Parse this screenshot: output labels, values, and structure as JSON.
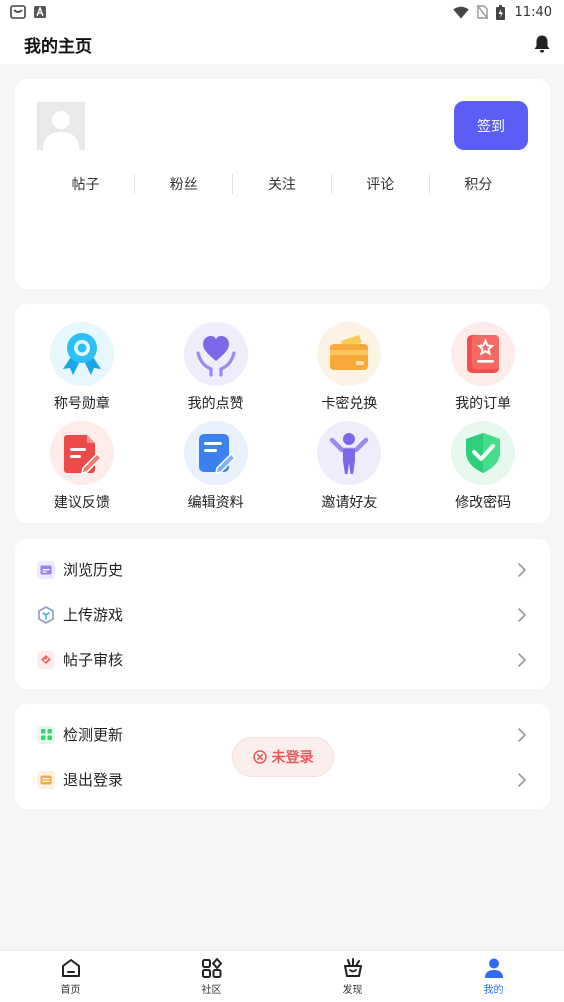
{
  "status_bar": {
    "time": "11:40"
  },
  "header": {
    "title": "我的主页"
  },
  "profile": {
    "signin_label": "签到",
    "stats": [
      "帖子",
      "粉丝",
      "关注",
      "评论",
      "积分"
    ]
  },
  "grid": [
    {
      "label": "称号勋章",
      "icon": "medal-icon"
    },
    {
      "label": "我的点赞",
      "icon": "heart-hands-icon"
    },
    {
      "label": "卡密兑换",
      "icon": "card-icon"
    },
    {
      "label": "我的订单",
      "icon": "order-icon"
    },
    {
      "label": "建议反馈",
      "icon": "feedback-icon"
    },
    {
      "label": "编辑资料",
      "icon": "edit-doc-icon"
    },
    {
      "label": "邀请好友",
      "icon": "invite-person-icon"
    },
    {
      "label": "修改密码",
      "icon": "shield-check-icon"
    }
  ],
  "list1": [
    {
      "label": "浏览历史",
      "icon": "history-icon"
    },
    {
      "label": "上传游戏",
      "icon": "upload-game-icon"
    },
    {
      "label": "帖子审核",
      "icon": "review-icon"
    }
  ],
  "list2": [
    {
      "label": "检测更新",
      "icon": "update-icon"
    },
    {
      "label": "退出登录",
      "icon": "logout-icon"
    }
  ],
  "toast": {
    "text": "未登录"
  },
  "tabs": [
    {
      "label": "首页",
      "icon": "home-icon"
    },
    {
      "label": "社区",
      "icon": "community-grid-icon"
    },
    {
      "label": "发现",
      "icon": "discover-icon"
    },
    {
      "label": "我的",
      "icon": "profile-icon",
      "active": true
    }
  ],
  "colors": {
    "accent": "#5b5df5",
    "active_tab": "#2f6bf2",
    "toast_text": "#e85a5a"
  }
}
